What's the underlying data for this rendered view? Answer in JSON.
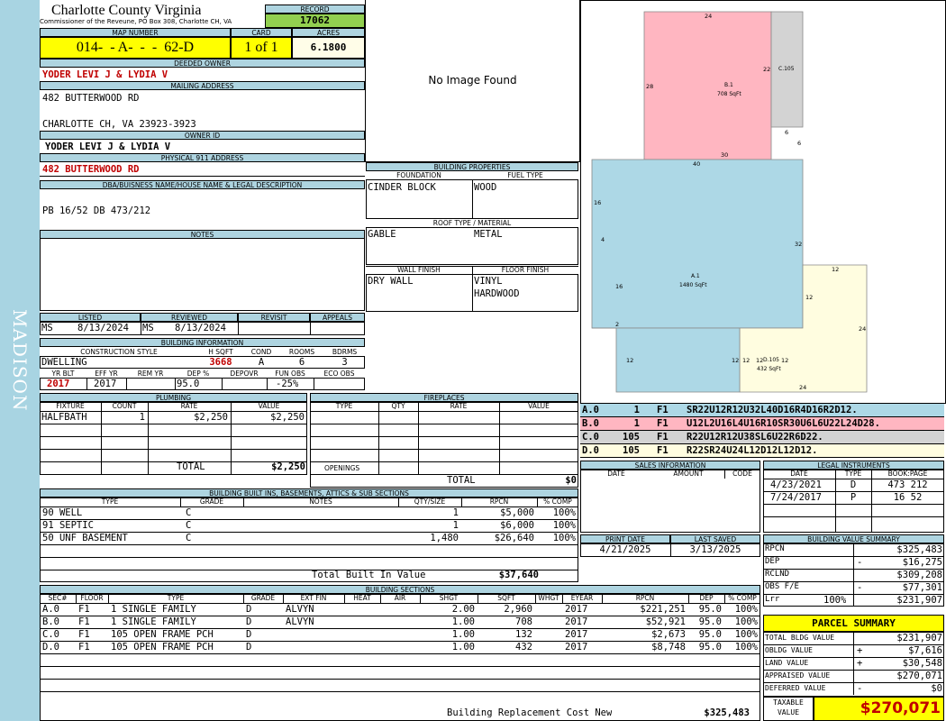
{
  "sidebar_text": "MADISON",
  "header": {
    "county": "Charlotte County Virginia",
    "commissioner": "Commissioner of the Reveune, PO Box 308, Charlotte CH, VA",
    "record_label": "RECORD",
    "record": "17062"
  },
  "parcel": {
    "map_number_label": "MAP NUMBER",
    "map_number": "014-  - A-  -  -  62-D",
    "card_label": "CARD",
    "card": "1 of 1",
    "acres_label": "ACRES",
    "acres": "6.1800"
  },
  "owner": {
    "deeded_owner_label": "DEEDED OWNER",
    "deeded_owner": "YODER LEVI J & LYDIA V",
    "mailing_label": "MAILING ADDRESS",
    "mailing_line1": "482 BUTTERWOOD RD",
    "mailing_line2": "CHARLOTTE CH, VA 23923-3923",
    "owner_id_label": "OWNER ID",
    "owner_id": "YODER LEVI J & LYDIA V",
    "physical_label": "PHYSICAL 911 ADDRESS",
    "physical": "482 BUTTERWOOD RD",
    "dba_label": "DBA/BUISNESS NAME/HOUSE NAME & LEGAL DESCRIPTION",
    "dba": "PB 16/52 DB 473/212",
    "notes_label": "NOTES"
  },
  "image_placeholder": "No Image Found",
  "listed": {
    "listed_label": "LISTED",
    "reviewed_label": "REVIEWED",
    "revisit_label": "REVISIT",
    "appeals_label": "APPEALS",
    "listed_by": "MS",
    "listed_date": "8/13/2024",
    "reviewed_by": "MS",
    "reviewed_date": "8/13/2024"
  },
  "building_info": {
    "title": "BUILDING INFORMATION",
    "construction_label": "CONSTRUCTION STYLE",
    "hsqft_label": "H SQFT",
    "cond_label": "COND",
    "rooms_label": "ROOMS",
    "bdrms_label": "BDRMS",
    "construction": "DWELLING",
    "hsqft": "3668",
    "cond": "A",
    "rooms": "6",
    "bdrms": "3",
    "yrblt_label": "YR BLT",
    "effyr_label": "EFF YR",
    "remyr_label": "REM YR",
    "dep_label": "DEP %",
    "depovr_label": "DEPOVR",
    "funobs_label": "FUN OBS",
    "ecoobs_label": "ECO OBS",
    "yrblt": "2017",
    "effyr": "2017",
    "dep": "95.0",
    "funobs": "-25%"
  },
  "building_properties": {
    "title": "BUILDING PROPERTIES",
    "foundation_label": "FOUNDATION",
    "fueltype_label": "FUEL TYPE",
    "foundation": "CINDER BLOCK",
    "fueltype": "WOOD",
    "roof_label": "ROOF TYPE / MATERIAL",
    "roof_type": "GABLE",
    "roof_material": "METAL",
    "wall_label": "WALL FINISH",
    "floor_label": "FLOOR FINISH",
    "wall": "DRY WALL",
    "floor1": "VINYL",
    "floor2": "HARDWOOD"
  },
  "sketch": {
    "areas": [
      {
        "code": "B.1",
        "sqft": "708 SqFt"
      },
      {
        "code": "C.105",
        "sqft": ""
      },
      {
        "code": "A.1",
        "sqft": "1480 SqFt"
      },
      {
        "code": "D.105",
        "sqft": "432 SqFt"
      }
    ],
    "dims": [
      "24",
      "22",
      "28",
      "30",
      "6",
      "6",
      "40",
      "16",
      "4",
      "32",
      "16",
      "2",
      "12",
      "12",
      "12",
      "12",
      "12",
      "24",
      "24",
      "12",
      "12"
    ]
  },
  "vectors": [
    {
      "code": "A.0",
      "n": "1",
      "fl": "F1",
      "vec": "SR22U12R12U32L40D16R4D16R2D12.",
      "color": "#add8e6"
    },
    {
      "code": "B.0",
      "n": "1",
      "fl": "F1",
      "vec": "U12L2U16L4U16R10SR30U6L6U22L24D28.",
      "color": "#ffb6c1"
    },
    {
      "code": "C.0",
      "n": "105",
      "fl": "F1",
      "vec": "R22U12R12U38SL6U22R6D22.",
      "color": "#d3d3d3"
    },
    {
      "code": "D.0",
      "n": "105",
      "fl": "F1",
      "vec": "R22SR24U24L12D12L12D12.",
      "color": "#fffde0"
    }
  ],
  "plumbing": {
    "title": "PLUMBING",
    "headers": [
      "FIXTURE",
      "COUNT",
      "RATE",
      "VALUE"
    ],
    "rows": [
      [
        "HALFBATH",
        "1",
        "$2,250",
        "$2,250"
      ]
    ],
    "total_label": "TOTAL",
    "total": "$2,250"
  },
  "fireplaces": {
    "title": "FIREPLACES",
    "headers": [
      "TYPE",
      "QTY",
      "RATE",
      "VALUE"
    ],
    "openings_label": "OPENINGS",
    "total_label": "TOTAL",
    "total": "$0"
  },
  "sales": {
    "title": "SALES INFORMATION",
    "headers": [
      "DATE",
      "AMOUNT",
      "CODE"
    ]
  },
  "legal": {
    "title": "LEGAL INSTRUMENTS",
    "headers": [
      "DATE",
      "TYPE",
      "BOOK:PAGE"
    ],
    "rows": [
      [
        "4/23/2021",
        "D",
        "473 212"
      ],
      [
        "7/24/2017",
        "P",
        "16 52"
      ]
    ]
  },
  "print": {
    "print_label": "PRINT DATE",
    "saved_label": "LAST SAVED",
    "print_date": "4/21/2025",
    "last_saved": "3/13/2025"
  },
  "builtins": {
    "title": "BUILDING BUILT INS, BASEMENTS, ATTICS & SUB SECTIONS",
    "headers": [
      "TYPE",
      "GRADE",
      "NOTES",
      "QTY/SIZE",
      "RPCN",
      "% COMP"
    ],
    "rows": [
      [
        "90 WELL",
        "C",
        "",
        "1",
        "$5,000",
        "100%"
      ],
      [
        "91 SEPTIC",
        "C",
        "",
        "1",
        "$6,000",
        "100%"
      ],
      [
        "50 UNF BASEMENT",
        "C",
        "",
        "1,480",
        "$26,640",
        "100%"
      ]
    ],
    "total_label": "Total Built In Value",
    "total": "$37,640"
  },
  "value_summary": {
    "title": "BUILDING VALUE SUMMARY",
    "rows": [
      {
        "label": "RPCN",
        "sign": "",
        "value": "$325,483"
      },
      {
        "label": "DEP",
        "sign": "-",
        "value": "$16,275"
      },
      {
        "label": "RCLND",
        "sign": "",
        "value": "$309,208"
      },
      {
        "label": "OBS F/E",
        "sign": "-",
        "value": "$77,301"
      },
      {
        "label": "Lrr",
        "pct": "100%",
        "sign": "",
        "value": "$231,907"
      }
    ]
  },
  "sections": {
    "title": "BUILDING SECTIONS",
    "headers": [
      "SEC#",
      "FLOOR",
      "TYPE",
      "GRADE",
      "EXT FIN",
      "HEAT",
      "AIR",
      "SHGT",
      "SQFT",
      "WHGT",
      "EYEAR",
      "RPCN",
      "DEP",
      "% COMP"
    ],
    "rows": [
      [
        "A.0",
        "F1",
        "1 SINGLE FAMILY",
        "D",
        "ALVYN",
        "",
        "",
        "2.00",
        "2,960",
        "",
        "2017",
        "$221,251",
        "95.0",
        "100%"
      ],
      [
        "B.0",
        "F1",
        "1 SINGLE FAMILY",
        "D",
        "ALVYN",
        "",
        "",
        "1.00",
        "708",
        "",
        "2017",
        "$52,921",
        "95.0",
        "100%"
      ],
      [
        "C.0",
        "F1",
        "105 OPEN FRAME PCH",
        "D",
        "",
        "",
        "",
        "1.00",
        "132",
        "",
        "2017",
        "$2,673",
        "95.0",
        "100%"
      ],
      [
        "D.0",
        "F1",
        "105 OPEN FRAME PCH",
        "D",
        "",
        "",
        "",
        "1.00",
        "432",
        "",
        "2017",
        "$8,748",
        "95.0",
        "100%"
      ]
    ],
    "total_label": "Building Replacement Cost New",
    "total": "$325,483"
  },
  "parcel_summary": {
    "title": "PARCEL SUMMARY",
    "rows": [
      {
        "label": "TOTAL BLDG VALUE",
        "sign": "",
        "value": "$231,907"
      },
      {
        "label": "OBLDG VALUE",
        "sign": "+",
        "value": "$7,616"
      },
      {
        "label": "LAND VALUE",
        "sign": "+",
        "value": "$30,548"
      },
      {
        "label": "APPRAISED VALUE",
        "sign": "",
        "value": "$270,071"
      },
      {
        "label": "DEFERRED VALUE",
        "sign": "-",
        "value": "$0"
      }
    ],
    "taxable_label1": "TAXABLE",
    "taxable_label2": "VALUE",
    "taxable": "$270,071"
  },
  "colors": {
    "header_blue": "#aed4e0",
    "sidebar": "#a8d4e2",
    "yellow": "#ffff00",
    "green": "#92d050",
    "red": "#c00000"
  }
}
